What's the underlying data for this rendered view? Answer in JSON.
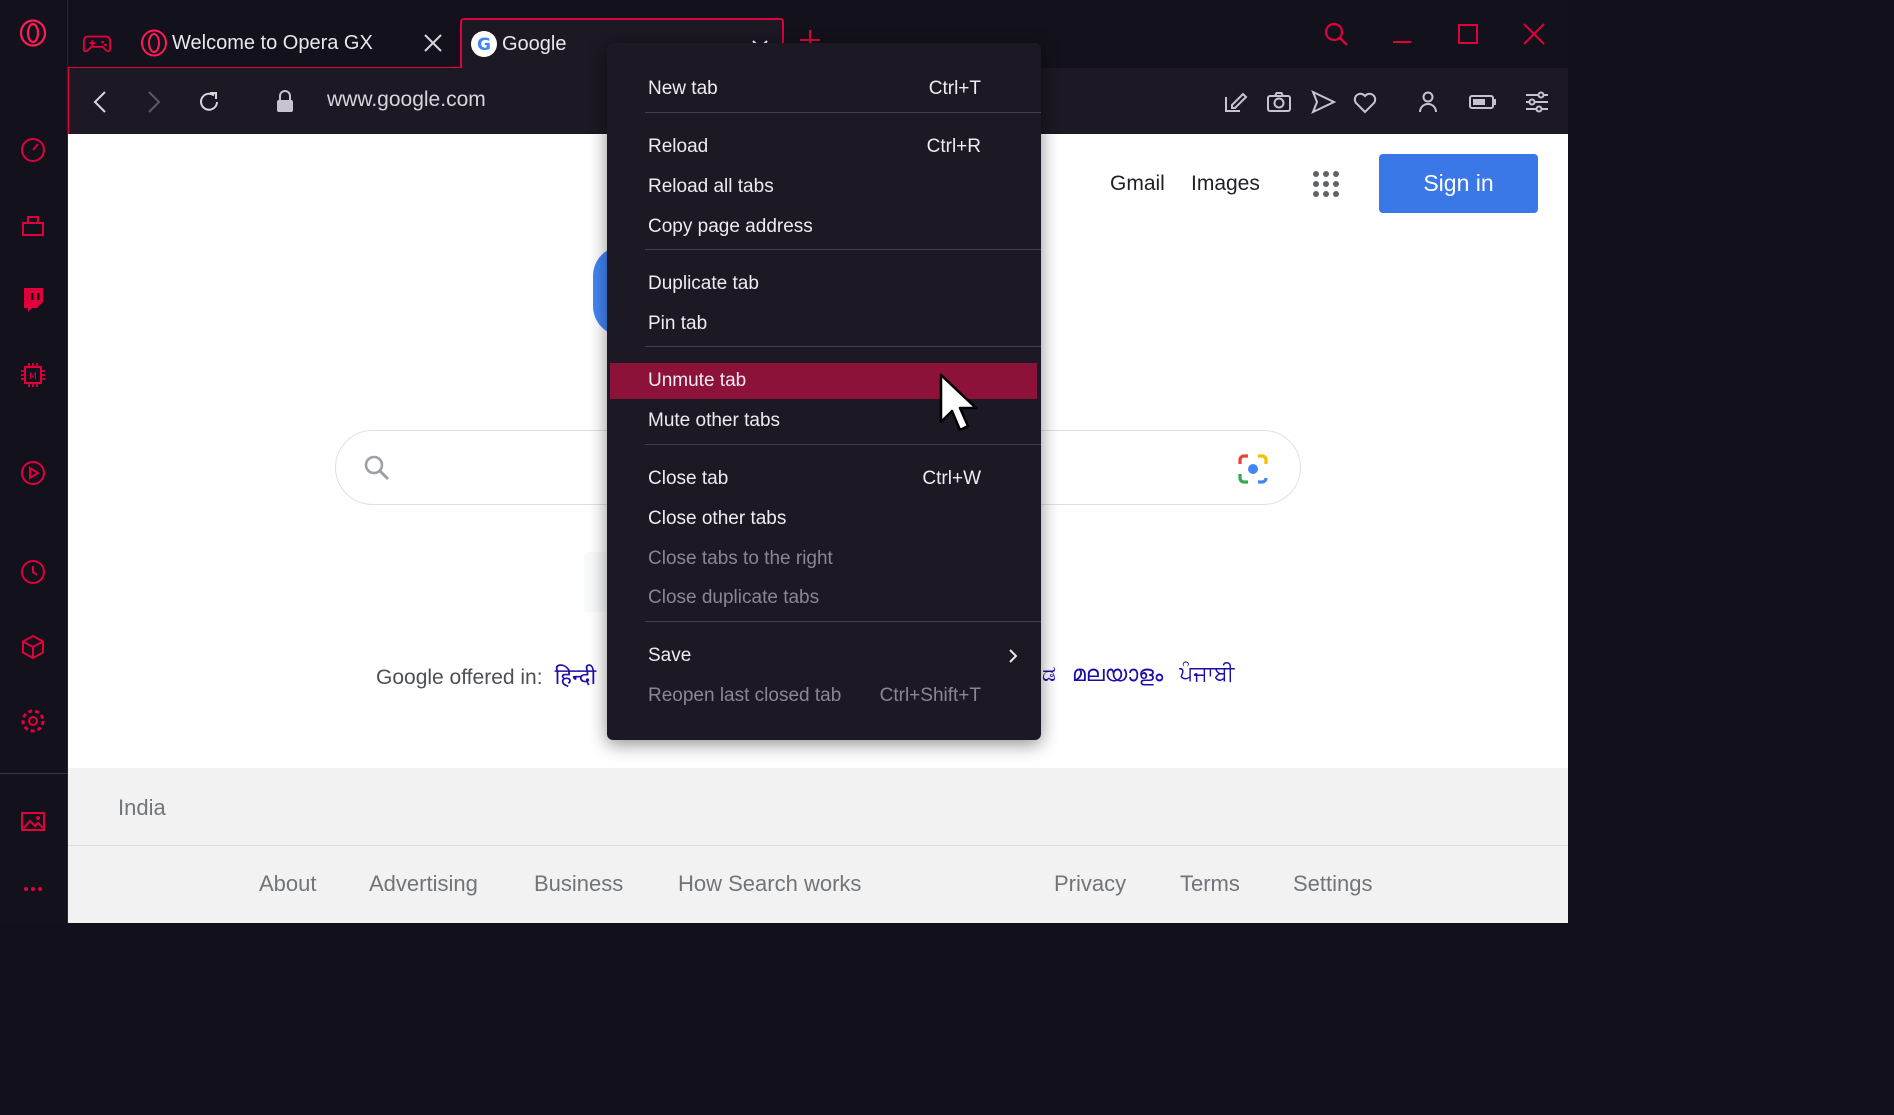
{
  "colors": {
    "accent": "#e0003c",
    "menu_bg": "#1c1824",
    "highlight": "#8c1239",
    "link": "#1a0dab",
    "signin": "#3b78e7"
  },
  "sidebar": {
    "icons": [
      "opera-logo-icon",
      "speed-dial-icon",
      "gx-corner-icon",
      "twitch-icon",
      "gx-control-icon",
      "player-icon",
      "history-icon",
      "extensions-icon",
      "settings-icon",
      "wallpaper-icon",
      "more-icon"
    ]
  },
  "tabs": [
    {
      "label": "Welcome to Opera GX",
      "active": false
    },
    {
      "label": "Google",
      "active": true
    }
  ],
  "address": {
    "url": "www.google.com"
  },
  "google": {
    "gmail": "Gmail",
    "images": "Images",
    "sign_in": "Sign in",
    "offered_label": "Google offered in:",
    "languages": [
      "हिन्दी",
      "ಡ",
      "മലയാളം",
      "ਪੰਜਾਬੀ"
    ],
    "country": "India",
    "footer_left": [
      "About",
      "Advertising",
      "Business",
      "How Search works"
    ],
    "footer_right": [
      "Privacy",
      "Terms",
      "Settings"
    ]
  },
  "menu": {
    "items": [
      {
        "label": "New tab",
        "shortcut": "Ctrl+T"
      },
      {
        "label": "Reload",
        "shortcut": "Ctrl+R"
      },
      {
        "label": "Reload all tabs",
        "shortcut": ""
      },
      {
        "label": "Copy page address",
        "shortcut": ""
      },
      {
        "label": "Duplicate tab",
        "shortcut": ""
      },
      {
        "label": "Pin tab",
        "shortcut": ""
      },
      {
        "label": "Unmute tab",
        "shortcut": ""
      },
      {
        "label": "Mute other tabs",
        "shortcut": ""
      },
      {
        "label": "Close tab",
        "shortcut": "Ctrl+W"
      },
      {
        "label": "Close other tabs",
        "shortcut": ""
      },
      {
        "label": "Close tabs to the right",
        "shortcut": ""
      },
      {
        "label": "Close duplicate tabs",
        "shortcut": ""
      },
      {
        "label": "Save",
        "shortcut": ""
      },
      {
        "label": "Reopen last closed tab",
        "shortcut": "Ctrl+Shift+T"
      }
    ]
  }
}
